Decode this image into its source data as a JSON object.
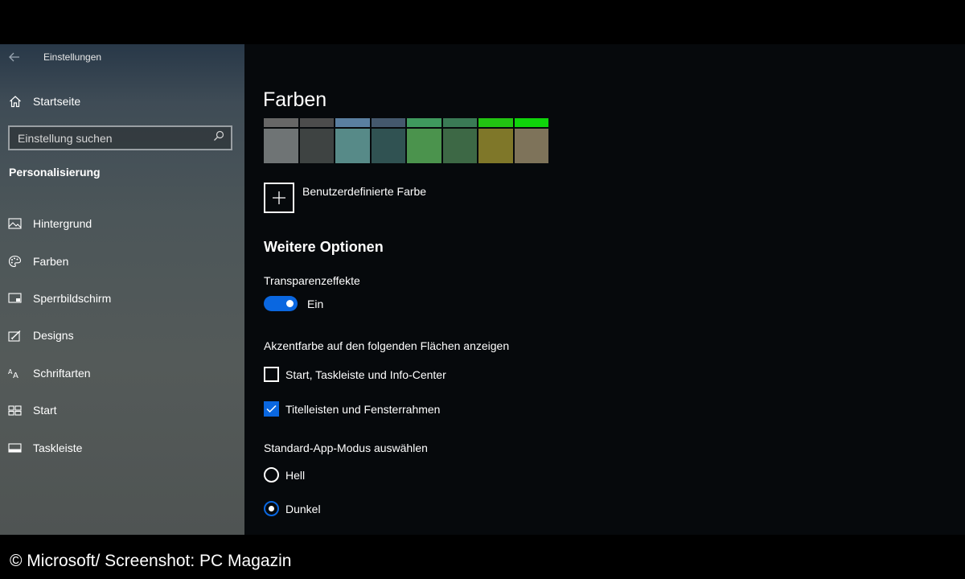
{
  "window": {
    "title": "Einstellungen",
    "back_icon": "back-arrow-icon"
  },
  "sidebar": {
    "home_label": "Startseite",
    "search_placeholder": "Einstellung suchen",
    "section_title": "Personalisierung",
    "items": [
      {
        "label": "Hintergrund",
        "icon": "image-icon"
      },
      {
        "label": "Farben",
        "icon": "palette-icon"
      },
      {
        "label": "Sperrbildschirm",
        "icon": "lock-screen-icon"
      },
      {
        "label": "Designs",
        "icon": "designs-icon"
      },
      {
        "label": "Schriftarten",
        "icon": "fonts-icon"
      },
      {
        "label": "Start",
        "icon": "start-icon"
      },
      {
        "label": "Taskleiste",
        "icon": "taskbar-icon"
      }
    ]
  },
  "main": {
    "title": "Farben",
    "swatches_top": [
      "#676767",
      "#4c4c4c",
      "#5a7fa0",
      "#44586d",
      "#3f9a5e",
      "#3a7a55",
      "#22c412",
      "#10d40b"
    ],
    "swatches_bottom": [
      "#6f7475",
      "#3e4342",
      "#578a88",
      "#305252",
      "#4b934d",
      "#3d6845",
      "#7f7729",
      "#7e735a"
    ],
    "custom_color_label": "Benutzerdefinierte Farbe",
    "more_options_title": "Weitere Optionen",
    "transparency": {
      "label": "Transparenzeffekte",
      "state": "Ein",
      "on": true
    },
    "accent": {
      "label": "Akzentfarbe auf den folgenden Flächen anzeigen",
      "options": [
        {
          "label": "Start, Taskleiste und Info-Center",
          "checked": false
        },
        {
          "label": "Titelleisten und Fensterrahmen",
          "checked": true
        }
      ]
    },
    "app_mode": {
      "label": "Standard-App-Modus auswählen",
      "options": [
        {
          "label": "Hell",
          "selected": false
        },
        {
          "label": "Dunkel",
          "selected": true
        }
      ]
    }
  },
  "caption": "© Microsoft/ Screenshot: PC Magazin",
  "colors": {
    "accent": "#0a67e0",
    "main_bg": "#06090c"
  }
}
